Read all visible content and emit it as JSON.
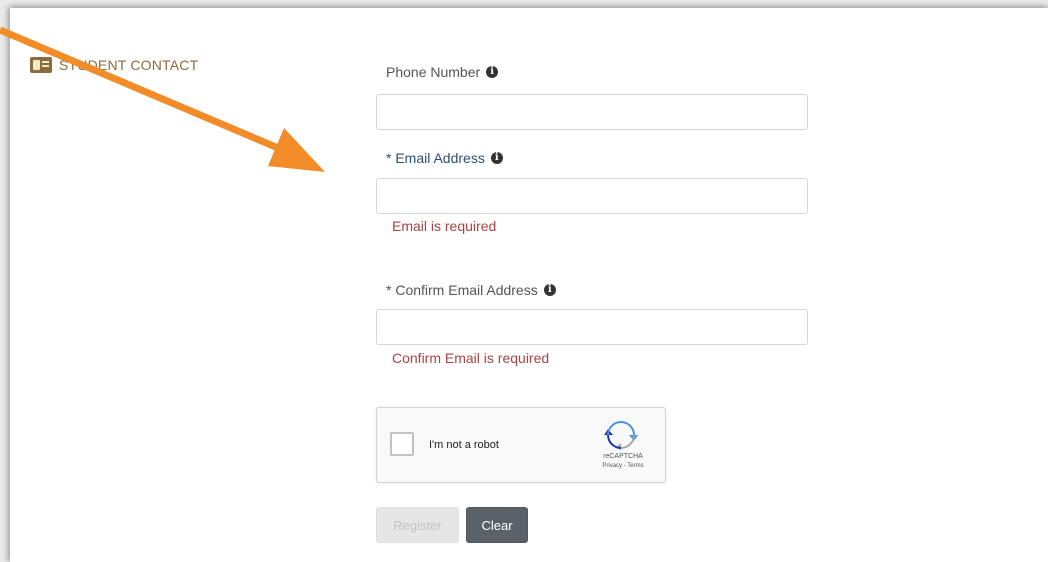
{
  "section": {
    "title": "STUDENT CONTACT",
    "icon": "id-card-icon"
  },
  "fields": {
    "phone": {
      "label": "Phone Number",
      "value": "",
      "info_icon": "info-icon"
    },
    "email": {
      "label": "* Email Address",
      "value": "",
      "error": "Email is required",
      "info_icon": "info-icon"
    },
    "confirm_email": {
      "label": "* Confirm Email Address",
      "value": "",
      "error": "Confirm Email is required",
      "info_icon": "info-icon"
    }
  },
  "recaptcha": {
    "label": "I'm not a robot",
    "brand": "reCAPTCHA",
    "links": "Privacy - Terms",
    "checked": false
  },
  "buttons": {
    "register": "Register",
    "clear": "Clear"
  },
  "annotation": {
    "color": "#f28c28",
    "icon": "arrow-annotation"
  },
  "colors": {
    "section_title": "#8a6d3b",
    "label": "#555555",
    "label_required": "#2c4f72",
    "error": "#a94442",
    "clear_button": "#5a6268"
  }
}
